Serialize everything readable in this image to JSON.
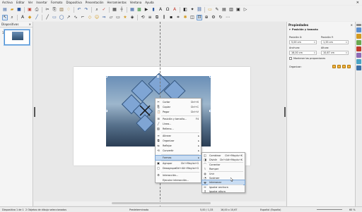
{
  "menubar": {
    "items": [
      "Archivo",
      "Editar",
      "Ver",
      "Insertar",
      "Formato",
      "Diapositiva",
      "Presentación",
      "Herramientas",
      "Ventana",
      "Ayuda"
    ],
    "close": "✕"
  },
  "slides_panel": {
    "title": "Diapositivas",
    "close": "✕",
    "slide_number": "1"
  },
  "properties": {
    "title": "Propiedades",
    "close": "✕",
    "section_position": "Posición y tamaño",
    "pos_x_label": "Posición X:",
    "pos_y_label": "Posición Y:",
    "pos_x_value": "5,00 cm",
    "pos_y_value": "1,33 cm",
    "width_label": "Anchura:",
    "height_label": "Altura:",
    "width_value": "16,00 cm",
    "height_value": "10,67 cm",
    "keep_ratio_label": "Mantener las proporciones",
    "arrange_label": "Organizar:"
  },
  "context_menu": {
    "items": [
      {
        "label": "Cortar",
        "shortcut": "Ctrl+X",
        "icon": "✂"
      },
      {
        "label": "Copiar",
        "shortcut": "Ctrl+C",
        "icon": "⎘"
      },
      {
        "label": "Pegar",
        "shortcut": "Ctrl+V",
        "icon": "📋"
      },
      {
        "label": "Posición y tamaño...",
        "shortcut": "F4",
        "icon": "⊞"
      },
      {
        "label": "Línea...",
        "shortcut": "",
        "icon": "╱"
      },
      {
        "label": "Relleno...",
        "shortcut": "",
        "icon": "▨"
      },
      {
        "label": "Alinear",
        "shortcut": "",
        "icon": "≡"
      },
      {
        "label": "Organizar",
        "shortcut": "",
        "icon": "⧉"
      },
      {
        "label": "Reflejar",
        "shortcut": "",
        "icon": "⇋"
      },
      {
        "label": "Convertir",
        "shortcut": "",
        "icon": "⟲"
      },
      {
        "label": "Formas",
        "shortcut": "",
        "icon": ""
      },
      {
        "label": "Agrupar",
        "shortcut": "Ctrl+Mayús+G",
        "icon": "▣"
      },
      {
        "label": "Desagrupar",
        "shortcut": "Ctrl+Alt+Mayús+G",
        "icon": "▢"
      },
      {
        "label": "Interacción...",
        "shortcut": "",
        "icon": "⚙"
      },
      {
        "label": "Ejecutar interacción...",
        "shortcut": "",
        "icon": ""
      }
    ],
    "arrow": "▸"
  },
  "submenu": {
    "items": [
      {
        "label": "Combinar",
        "shortcut": "Ctrl+Mayús+K",
        "icon": "◫"
      },
      {
        "label": "Dividir",
        "shortcut": "Ctrl+Alt+Mayús+K",
        "icon": "◨"
      },
      {
        "label": "Conectar",
        "shortcut": "",
        "icon": "⌒"
      },
      {
        "label": "Romper",
        "shortcut": "",
        "icon": "⌇"
      },
      {
        "label": "Unir",
        "shortcut": "",
        "icon": "◍"
      },
      {
        "label": "Sustraer",
        "shortcut": "",
        "icon": "◔"
      },
      {
        "label": "Intersecar",
        "shortcut": "",
        "icon": "◒"
      },
      {
        "label": "Igualar anchura",
        "shortcut": "",
        "icon": "↔"
      },
      {
        "label": "Igualar altura",
        "shortcut": "",
        "icon": "↕"
      }
    ]
  },
  "statusbar": {
    "slide": "Diapositiva 1 de 1",
    "selection": "2 Objetos de dibujo seleccionados",
    "layout": "Predeterminado",
    "position": "5,00 / 1,33",
    "size": "16,00 x 10,67",
    "language": "Español (España)",
    "zoom": "60 %"
  }
}
